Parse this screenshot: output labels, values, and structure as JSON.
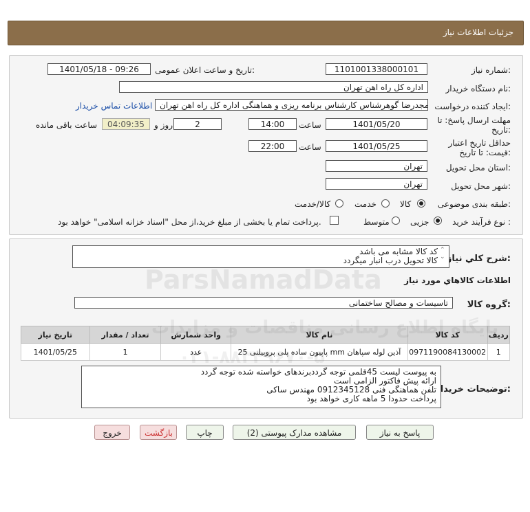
{
  "header": {
    "title": "جزئیات اطلاعات نیاز"
  },
  "form": {
    "need_number_label": "شماره نیاز:",
    "need_number": "1101001338000101",
    "announce_label": "تاریخ و ساعت اعلان عمومی:",
    "announce_value": "1401/05/18 - 09:26",
    "buyer_label": "نام دستگاه خریدار:",
    "buyer_value": "اداره کل راه اهن تهران",
    "creator_label": "ایجاد کننده درخواست:",
    "creator_value": "مجدرضا گوهرشناس کارشناس برنامه ریزی و هماهنگی اداره کل راه اهن تهران",
    "contact_link": "اطلاعات تماس خریدار",
    "deadline_label_1": "مهلت ارسال پاسخ: تا",
    "deadline_label_2": "تاریخ:",
    "deadline_date": "1401/05/20",
    "time_label": "ساعت",
    "deadline_time": "14:00",
    "days_value": "2",
    "days_label": "روز و",
    "remaining_time": "04:09:35",
    "remaining_label": "ساعت باقی مانده",
    "validity_label_1": "حداقل تاریخ اعتبار",
    "validity_label_2": "قیمت: تا تاریخ:",
    "validity_date": "1401/05/25",
    "validity_time_label": "ساعت",
    "validity_time": "22:00",
    "province_label": "استان محل تحویل:",
    "province_value": "تهران",
    "city_label": "شهر محل تحویل:",
    "city_value": "تهران",
    "category_label": "طبقه بندی موضوعی:",
    "category_options": [
      "کالا",
      "خدمت",
      "کالا/خدمت"
    ],
    "process_label": "نوع فرآیند خرید :",
    "process_options": [
      "جزیی",
      "متوسط"
    ],
    "payment_note": "پرداخت تمام یا بخشی از مبلغ خرید،از محل \"اسناد خزانه اسلامی\" خواهد بود."
  },
  "description": {
    "label": "شرح کلي نياز:",
    "lines": [
      "کد کالا مشابه می باشد",
      "کالا تحویل درب انبار میگردد"
    ]
  },
  "goods": {
    "section_title": "اطلاعات کالاهاي مورد نياز",
    "group_label": "گروه کالا:",
    "group_value": "تاسیسات و مصالح ساختمانی",
    "columns": [
      "ردیف",
      "کد کالا",
      "نام کالا",
      "واحد شمارش",
      "تعداد / مقدار",
      "تاریخ نیاز"
    ],
    "rows": [
      [
        "1",
        "0971190084130002",
        "پاپیون ساده پلی پروپیلنی 25 mm آذین لوله سپاهان",
        "عدد",
        "1",
        "1401/05/25"
      ]
    ]
  },
  "buyer_notes": {
    "label": "توضیحات خریدار:",
    "lines": [
      "به پیوست لیست 45قلمی توجه گرددبرندهای خواسته شده توجه گردد",
      "ارائه پیش فاکتور الزامی است",
      "تلفن هماهنگی فنی 0912345128 مهندس ساکی",
      "پرداخت حدودا 5 ماهه کاری خواهد بود"
    ]
  },
  "buttons": {
    "reply": "پاسخ به نیاز",
    "attachments": "مشاهده مدارک پیوستی (2)",
    "print": "چاپ",
    "back": "بازگشت",
    "exit": "خروج"
  },
  "watermark": {
    "brand": "ParsNamadData",
    "tagline": "پایگاه اطلاع رسانی مناقصات و مزایدات",
    "phone": "۰۲۱-۸۸۳۴۹۶۷۰-۵"
  }
}
